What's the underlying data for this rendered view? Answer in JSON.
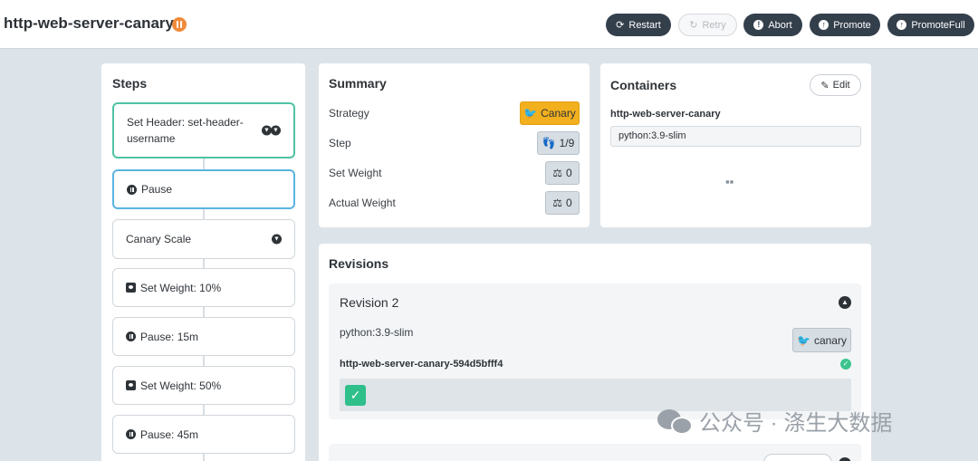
{
  "header": {
    "title": "http-web-server-canary",
    "buttons": [
      {
        "label": "Restart",
        "icon": "refresh-icon",
        "disabled": false
      },
      {
        "label": "Retry",
        "icon": "retry-icon",
        "disabled": true
      },
      {
        "label": "Abort",
        "icon": "exclamation-circle-icon",
        "disabled": false
      },
      {
        "label": "Promote",
        "icon": "arrow-up-circle-icon",
        "disabled": false
      },
      {
        "label": "PromoteFull",
        "icon": "arrow-up-circle-icon",
        "disabled": false
      }
    ]
  },
  "steps": {
    "title": "Steps",
    "items": [
      {
        "label": "Set Header: set-header-username",
        "status": "done",
        "icon": "double-chevron-down-icon"
      },
      {
        "label": "Pause",
        "status": "active",
        "icon": "pause-icon"
      },
      {
        "label": "Canary Scale",
        "status": "pending",
        "icon": "chevron-down-icon"
      },
      {
        "label": "Set Weight: 10%",
        "status": "pending",
        "icon": "weight-icon"
      },
      {
        "label": "Pause: 15m",
        "status": "pending",
        "icon": "pause-icon"
      },
      {
        "label": "Set Weight: 50%",
        "status": "pending",
        "icon": "weight-icon"
      },
      {
        "label": "Pause: 45m",
        "status": "pending",
        "icon": "pause-icon"
      }
    ]
  },
  "summary": {
    "title": "Summary",
    "rows": [
      {
        "label": "Strategy",
        "value": "Canary",
        "icon": "bird-icon"
      },
      {
        "label": "Step",
        "value": "1/9",
        "icon": "shoe-prints-icon"
      },
      {
        "label": "Set Weight",
        "value": "0",
        "icon": "balance-scale-icon"
      },
      {
        "label": "Actual Weight",
        "value": "0",
        "icon": "balance-scale-icon"
      }
    ],
    "strategy_color": "#f2b01e"
  },
  "containers": {
    "title": "Containers",
    "edit_label": "Edit",
    "name": "http-web-server-canary",
    "image": "python:3.9-slim"
  },
  "revisions": {
    "title": "Revisions",
    "items": [
      {
        "title": "Revision 2",
        "image": "python:3.9-slim",
        "badge": "canary",
        "replicaset": "http-web-server-canary-594d5bfff4"
      }
    ]
  },
  "watermark": {
    "text": "公众号 · 涤生大数据"
  },
  "colors": {
    "accent_green": "#3cc48e",
    "active_blue": "#5ab4e0",
    "paused_orange": "#f08b3b",
    "dark_button": "#343f4c"
  }
}
